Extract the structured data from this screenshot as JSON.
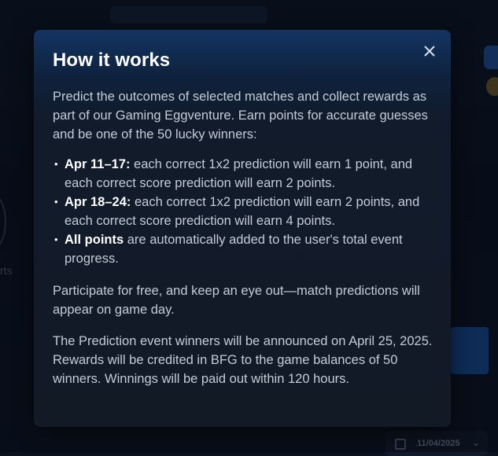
{
  "background": {
    "left_partial_text": "rts",
    "date_pill": "11/04/2025"
  },
  "modal": {
    "title": "How it works",
    "intro": "Predict the outcomes of selected matches and collect rewards as part of our Gaming Eggventure. Earn points for accurate guesses and be one of the 50 lucky winners:",
    "bullets": [
      {
        "strong": "Apr 11–17:",
        "text": " each correct 1x2 prediction will earn 1 point, and each correct score prediction will earn 2 points."
      },
      {
        "strong": "Apr 18–24:",
        "text": " each correct 1x2 prediction will earn 2 points, and each correct score prediction will earn 4 points."
      },
      {
        "strong": "All points",
        "text": " are automatically added to the user's total event progress."
      }
    ],
    "paragraph_participate": "Participate for free, and keep an eye out—match predictions will appear on game day.",
    "paragraph_winners": "The Prediction event winners will be announced on April 25, 2025. Rewards will be credited in BFG to the game balances of 50 winners. Winnings will be paid out within 120 hours.",
    "close_icon": "close-icon"
  },
  "colors": {
    "modal_top": "#123462",
    "modal_bg": "#121a26",
    "body_text": "#c3cbd6",
    "title_text": "#ffffff",
    "accent_blue": "#154a92"
  }
}
